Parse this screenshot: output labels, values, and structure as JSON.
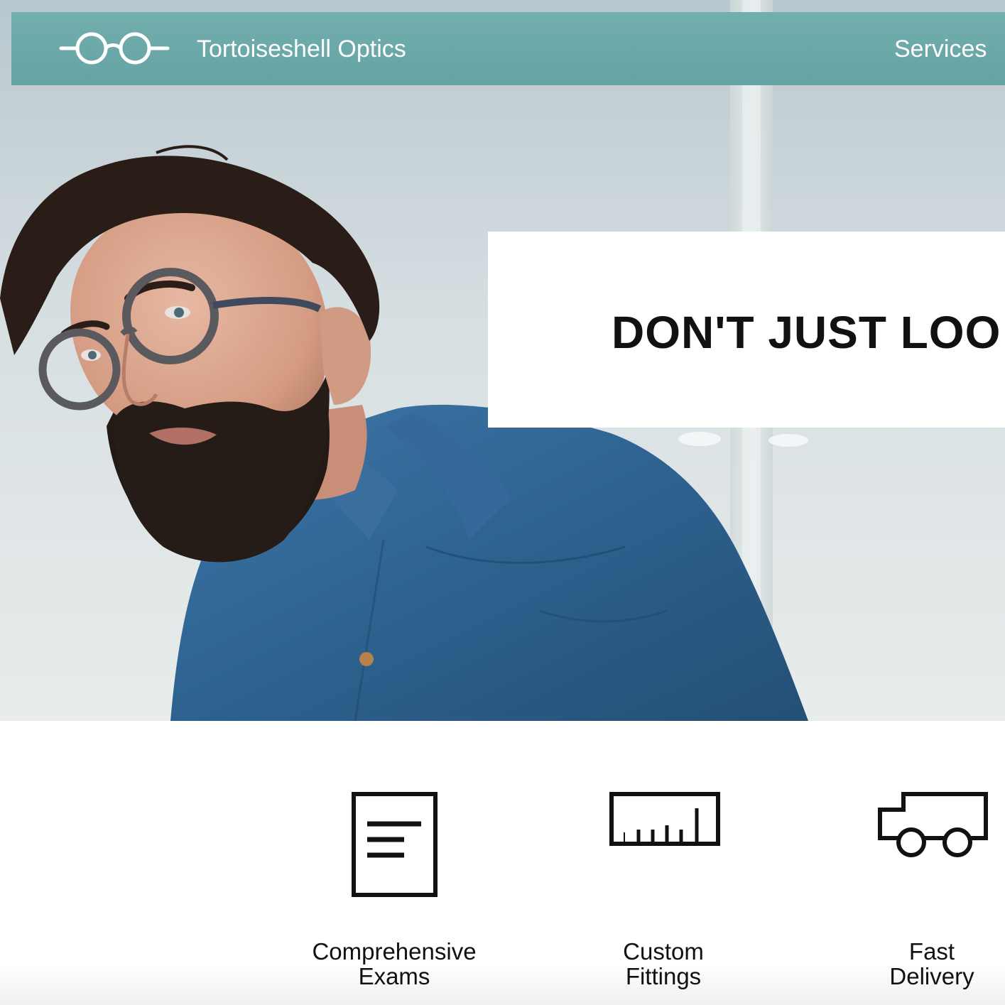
{
  "header": {
    "brand_name": "Tortoiseshell Optics",
    "logo_icon": "glasses-icon",
    "nav": [
      {
        "label": "Services"
      }
    ],
    "background_color": "#6aa8a8"
  },
  "hero": {
    "headline": "DON'T JUST LOO",
    "image": "man-with-glasses-photo"
  },
  "features": [
    {
      "icon": "document-icon",
      "line1": "Comprehensive",
      "line2": "Exams"
    },
    {
      "icon": "ruler-icon",
      "line1": "Custom",
      "line2": "Fittings"
    },
    {
      "icon": "truck-icon",
      "line1": "Fast",
      "line2": "Delivery"
    }
  ]
}
